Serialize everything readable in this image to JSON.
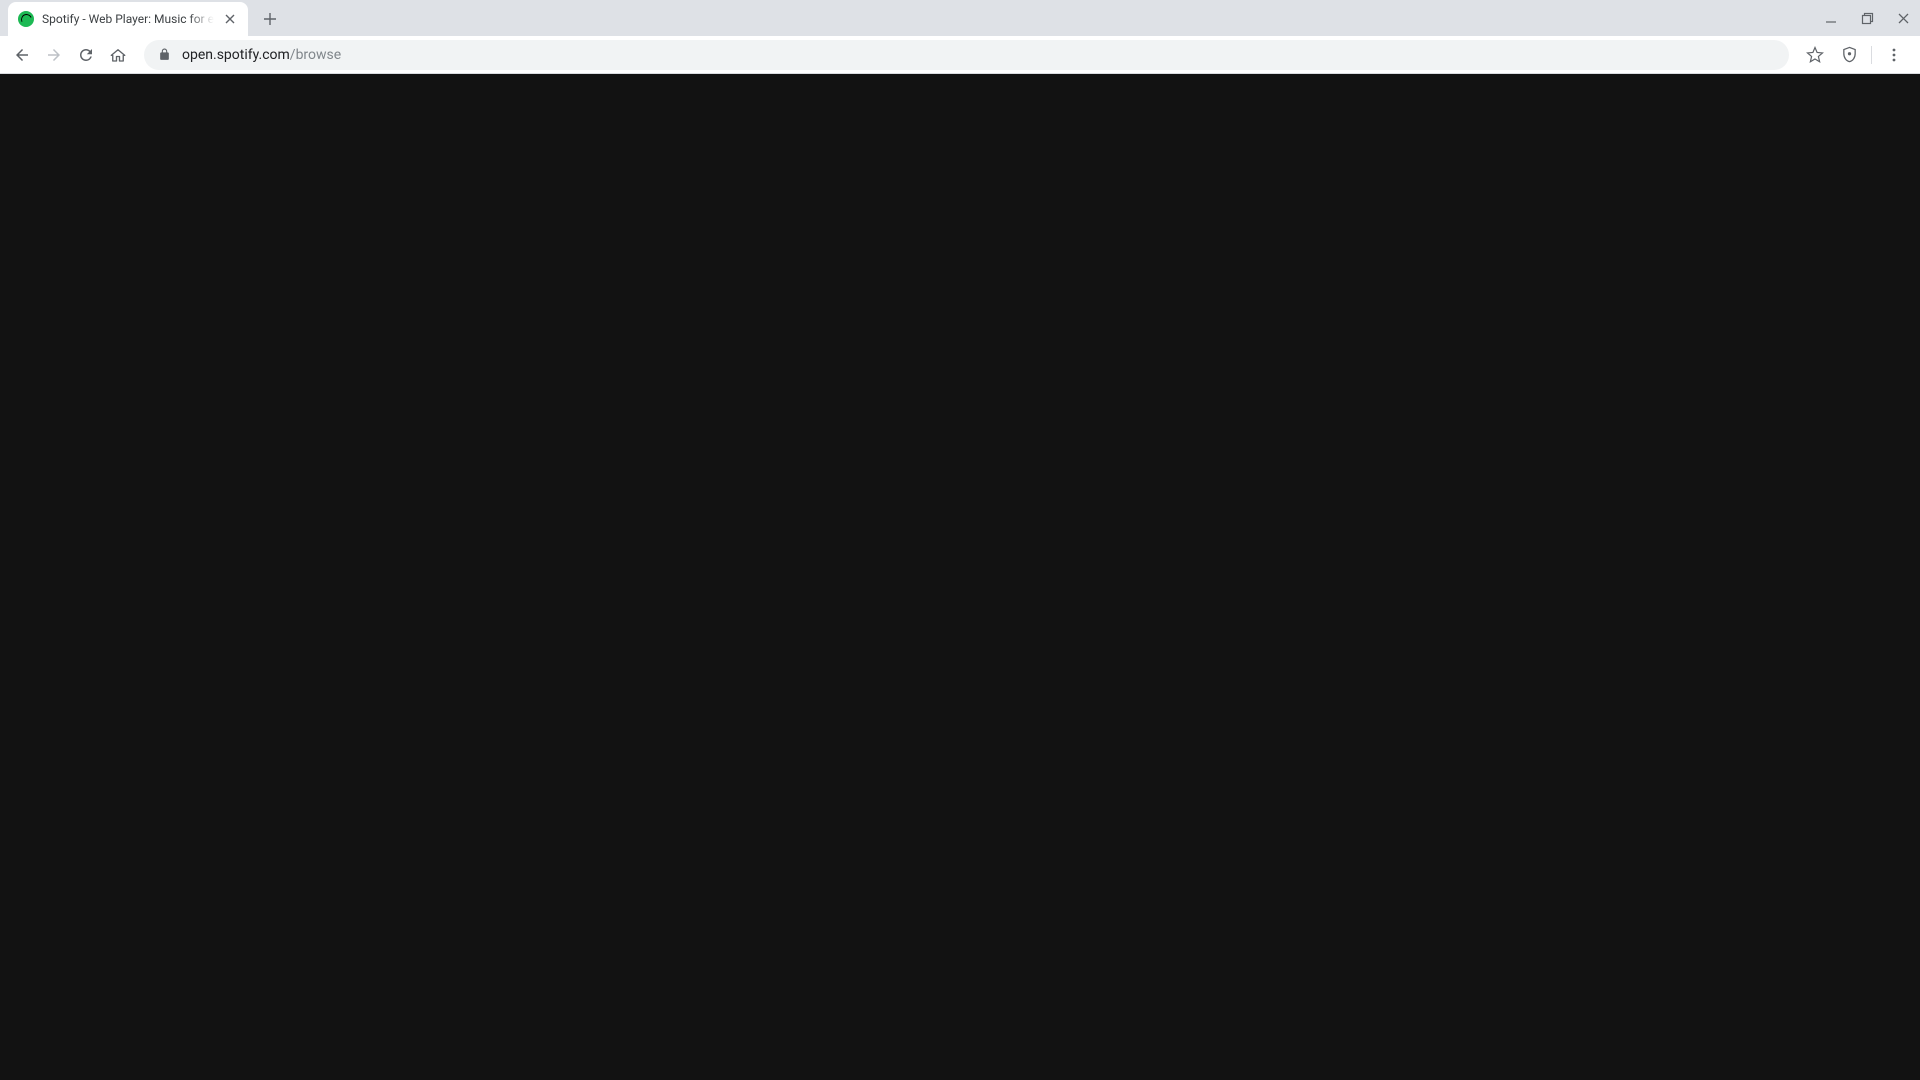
{
  "tab": {
    "title": "Spotify - Web Player: Music for everyone",
    "favicon_color": "#1db954"
  },
  "url": {
    "host": "open.spotify.com",
    "path": "/browse"
  },
  "content": {
    "background": "#121212"
  }
}
